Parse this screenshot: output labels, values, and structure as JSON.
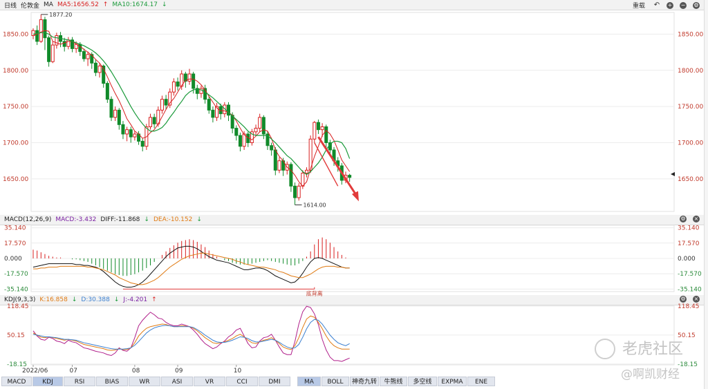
{
  "header": {
    "period": "日线",
    "symbol": "伦敦金",
    "indicator": "MA",
    "ma5": "MA5:1656.52",
    "ma10": "MA10:1674.17",
    "reset": "重载"
  },
  "macd_header": {
    "name": "MACD(12,26,9)",
    "macd": "MACD:-3.432",
    "diff": "DIFF:-11.868",
    "dea": "DEA:-10.152"
  },
  "kdj_header": {
    "name": "KDJ(9,3,3)",
    "k": "K:16.858",
    "d": "D:30.388",
    "j": "J:-4.201"
  },
  "tabs_left": [
    "MACD",
    "KDJ",
    "RSI",
    "BIAS",
    "WR",
    "ASI",
    "VR",
    "CCI",
    "DMI"
  ],
  "tabs_right": [
    "MA",
    "BOLL",
    "神奇九转",
    "牛熊线",
    "多空线",
    "EXPMA",
    "ENE"
  ],
  "watermark": {
    "brand": "老虎社区",
    "author": "@啊凯财经"
  },
  "colors": {
    "up": "#d81e1e",
    "down": "#118a2a",
    "ma_green": "#1a9a3a",
    "orange": "#e07a12",
    "purple": "#b01e8a",
    "blue": "#3a7fd0",
    "black": "#111111"
  },
  "chart_data": [
    {
      "type": "candlestick",
      "title": "伦敦金 日线",
      "yticks": [
        "1850.00",
        "1800.00",
        "1750.00",
        "1700.00",
        "1650.00"
      ],
      "yvalues": [
        1850,
        1800,
        1750,
        1700,
        1650
      ],
      "ylim": [
        1605,
        1880
      ],
      "xticks": [
        "2022/06",
        "07",
        "08",
        "09",
        "10"
      ],
      "annotations": {
        "high": "1877.20",
        "high_value": 1877.2,
        "low": "1614.00",
        "low_value": 1614.0
      },
      "candles": [
        [
          1848,
          1855,
          1843,
          1858
        ],
        [
          1855,
          1840,
          1835,
          1862
        ],
        [
          1840,
          1870,
          1838,
          1877.2
        ],
        [
          1870,
          1845,
          1828,
          1874
        ],
        [
          1845,
          1812,
          1805,
          1848
        ],
        [
          1812,
          1835,
          1810,
          1840
        ],
        [
          1835,
          1848,
          1830,
          1852
        ],
        [
          1848,
          1840,
          1832,
          1853
        ],
        [
          1840,
          1833,
          1826,
          1845
        ],
        [
          1833,
          1842,
          1829,
          1846
        ],
        [
          1842,
          1830,
          1825,
          1846
        ],
        [
          1830,
          1836,
          1824,
          1840
        ],
        [
          1836,
          1826,
          1820,
          1839
        ],
        [
          1826,
          1816,
          1812,
          1830
        ],
        [
          1816,
          1822,
          1806,
          1826
        ],
        [
          1822,
          1810,
          1802,
          1825
        ],
        [
          1810,
          1797,
          1792,
          1815
        ],
        [
          1797,
          1806,
          1790,
          1810
        ],
        [
          1806,
          1782,
          1776,
          1808
        ],
        [
          1782,
          1760,
          1755,
          1785
        ],
        [
          1760,
          1735,
          1730,
          1764
        ],
        [
          1735,
          1745,
          1730,
          1750
        ],
        [
          1745,
          1725,
          1718,
          1748
        ],
        [
          1725,
          1712,
          1705,
          1730
        ],
        [
          1712,
          1718,
          1702,
          1722
        ],
        [
          1718,
          1708,
          1700,
          1722
        ],
        [
          1708,
          1712,
          1703,
          1716
        ],
        [
          1712,
          1702,
          1697,
          1716
        ],
        [
          1702,
          1695,
          1688,
          1706
        ],
        [
          1695,
          1722,
          1690,
          1726
        ],
        [
          1722,
          1735,
          1718,
          1740
        ],
        [
          1735,
          1726,
          1720,
          1740
        ],
        [
          1726,
          1745,
          1722,
          1750
        ],
        [
          1745,
          1760,
          1740,
          1765
        ],
        [
          1760,
          1752,
          1746,
          1766
        ],
        [
          1752,
          1770,
          1748,
          1775
        ],
        [
          1770,
          1784,
          1765,
          1789
        ],
        [
          1784,
          1778,
          1772,
          1790
        ],
        [
          1778,
          1795,
          1773,
          1800
        ],
        [
          1795,
          1785,
          1776,
          1798
        ],
        [
          1785,
          1795,
          1780,
          1802
        ],
        [
          1795,
          1775,
          1768,
          1798
        ],
        [
          1775,
          1768,
          1760,
          1780
        ],
        [
          1768,
          1775,
          1762,
          1779
        ],
        [
          1775,
          1760,
          1754,
          1780
        ],
        [
          1760,
          1745,
          1740,
          1764
        ],
        [
          1745,
          1735,
          1728,
          1750
        ],
        [
          1735,
          1750,
          1730,
          1755
        ],
        [
          1750,
          1740,
          1732,
          1754
        ],
        [
          1740,
          1752,
          1735,
          1756
        ],
        [
          1752,
          1738,
          1730,
          1756
        ],
        [
          1738,
          1720,
          1713,
          1742
        ],
        [
          1720,
          1710,
          1703,
          1724
        ],
        [
          1710,
          1695,
          1688,
          1714
        ],
        [
          1695,
          1712,
          1690,
          1716
        ],
        [
          1712,
          1700,
          1694,
          1715
        ],
        [
          1700,
          1715,
          1696,
          1719
        ],
        [
          1715,
          1720,
          1710,
          1725
        ],
        [
          1720,
          1735,
          1715,
          1740
        ],
        [
          1735,
          1712,
          1705,
          1738
        ],
        [
          1712,
          1696,
          1690,
          1716
        ],
        [
          1696,
          1690,
          1682,
          1700
        ],
        [
          1690,
          1662,
          1655,
          1694
        ],
        [
          1662,
          1675,
          1658,
          1680
        ],
        [
          1675,
          1662,
          1654,
          1679
        ],
        [
          1662,
          1670,
          1656,
          1674
        ],
        [
          1670,
          1640,
          1632,
          1673
        ],
        [
          1640,
          1624,
          1614,
          1645
        ],
        [
          1624,
          1640,
          1620,
          1644
        ],
        [
          1640,
          1658,
          1636,
          1662
        ],
        [
          1658,
          1662,
          1652,
          1666
        ],
        [
          1662,
          1705,
          1658,
          1710
        ],
        [
          1705,
          1728,
          1700,
          1730
        ],
        [
          1728,
          1718,
          1712,
          1732
        ],
        [
          1718,
          1722,
          1708,
          1727
        ],
        [
          1722,
          1700,
          1692,
          1725
        ],
        [
          1700,
          1690,
          1684,
          1704
        ],
        [
          1690,
          1675,
          1668,
          1694
        ],
        [
          1675,
          1668,
          1660,
          1680
        ],
        [
          1668,
          1648,
          1642,
          1672
        ],
        [
          1648,
          1655,
          1644,
          1660
        ],
        [
          1655,
          1652,
          1646,
          1657
        ]
      ],
      "ma5": [
        1848,
        1850,
        1853,
        1855,
        1854,
        1840,
        1838,
        1836,
        1838,
        1840,
        1840,
        1836,
        1833,
        1829,
        1825,
        1821,
        1815,
        1810,
        1802,
        1791,
        1779,
        1768,
        1758,
        1746,
        1733,
        1725,
        1716,
        1712,
        1706,
        1708,
        1714,
        1718,
        1726,
        1736,
        1746,
        1755,
        1761,
        1770,
        1779,
        1786,
        1788,
        1788,
        1785,
        1780,
        1773,
        1764,
        1756,
        1748,
        1744,
        1744,
        1742,
        1738,
        1730,
        1720,
        1711,
        1707,
        1704,
        1709,
        1715,
        1718,
        1716,
        1706,
        1690,
        1681,
        1675,
        1666,
        1662,
        1655,
        1646,
        1640,
        1646,
        1664,
        1681,
        1695,
        1710,
        1717,
        1712,
        1703,
        1690,
        1676,
        1668,
        1660
      ],
      "ma10": [
        1850,
        1851,
        1852,
        1852,
        1850,
        1846,
        1845,
        1844,
        1843,
        1842,
        1840,
        1838,
        1836,
        1834,
        1831,
        1828,
        1824,
        1819,
        1813,
        1806,
        1798,
        1789,
        1780,
        1770,
        1760,
        1750,
        1741,
        1733,
        1726,
        1720,
        1716,
        1716,
        1718,
        1721,
        1727,
        1735,
        1742,
        1750,
        1757,
        1765,
        1770,
        1773,
        1774,
        1773,
        1770,
        1766,
        1762,
        1757,
        1752,
        1747,
        1742,
        1737,
        1732,
        1727,
        1722,
        1716,
        1712,
        1710,
        1710,
        1710,
        1710,
        1705,
        1700,
        1694,
        1688,
        1682,
        1678,
        1672,
        1666,
        1660,
        1656,
        1660,
        1666,
        1672,
        1680,
        1690,
        1698,
        1702,
        1702,
        1700,
        1692,
        1678
      ]
    },
    {
      "type": "bar+line",
      "title": "MACD(12,26,9)",
      "yticks": [
        "35.140",
        "17.570",
        "0.000",
        "-17.570",
        "-35.140"
      ],
      "yvalues": [
        35.14,
        17.57,
        0,
        -17.57,
        -35.14
      ],
      "ylim": [
        -38,
        38
      ],
      "annotation": "底背离",
      "macd_hist": [
        10,
        9,
        7,
        5,
        3,
        2,
        1,
        1,
        0,
        0,
        -1,
        -1,
        -2,
        -3,
        -4,
        -6,
        -8,
        -10,
        -12,
        -14,
        -16,
        -18,
        -19,
        -20,
        -20,
        -19,
        -18,
        -16,
        -14,
        -11,
        -8,
        -4,
        0,
        4,
        8,
        12,
        15,
        18,
        20,
        21,
        22,
        21,
        19,
        16,
        13,
        9,
        5,
        2,
        0,
        -2,
        -3,
        -5,
        -6,
        -7,
        -7,
        -7,
        -6,
        -5,
        -4,
        -3,
        -2,
        -3,
        -4,
        -5,
        -6,
        -7,
        -8,
        -8,
        -6,
        -3,
        2,
        8,
        16,
        22,
        24,
        22,
        18,
        13,
        8,
        4,
        1,
        0
      ],
      "diff": [
        -10,
        -9,
        -8,
        -7,
        -6,
        -6,
        -6,
        -6,
        -6,
        -6,
        -6,
        -7,
        -7,
        -8,
        -8,
        -9,
        -10,
        -12,
        -15,
        -19,
        -23,
        -27,
        -30,
        -32,
        -33,
        -33,
        -32,
        -30,
        -27,
        -23,
        -18,
        -13,
        -8,
        -3,
        2,
        6,
        9,
        12,
        13,
        14,
        14,
        13,
        11,
        8,
        5,
        2,
        0,
        -2,
        -3,
        -4,
        -5,
        -7,
        -9,
        -11,
        -13,
        -13,
        -12,
        -11,
        -11,
        -12,
        -14,
        -17,
        -20,
        -22,
        -24,
        -26,
        -28,
        -27,
        -23,
        -17,
        -10,
        -4,
        0,
        1,
        0,
        -2,
        -4,
        -6,
        -8,
        -10,
        -11,
        -11
      ],
      "dea": [
        -12,
        -12,
        -11,
        -11,
        -10,
        -10,
        -10,
        -9,
        -9,
        -9,
        -9,
        -9,
        -9,
        -9,
        -10,
        -10,
        -11,
        -12,
        -13,
        -15,
        -17,
        -19,
        -22,
        -24,
        -26,
        -28,
        -29,
        -30,
        -30,
        -29,
        -27,
        -25,
        -22,
        -18,
        -14,
        -10,
        -7,
        -4,
        -1,
        1,
        3,
        4,
        5,
        6,
        6,
        5,
        4,
        3,
        2,
        1,
        0,
        -1,
        -3,
        -4,
        -6,
        -7,
        -8,
        -9,
        -10,
        -10,
        -11,
        -12,
        -13,
        -15,
        -16,
        -18,
        -20,
        -21,
        -22,
        -22,
        -20,
        -18,
        -15,
        -12,
        -10,
        -9,
        -9,
        -9,
        -10,
        -10,
        -11,
        -11
      ]
    },
    {
      "type": "line",
      "title": "KDJ(9,3,3)",
      "yticks": [
        "118.45",
        "50.15",
        "-18.15"
      ],
      "yvalues": [
        118.45,
        50.15,
        -18.15
      ],
      "ylim": [
        -20,
        120
      ],
      "k": [
        55,
        50,
        45,
        44,
        46,
        44,
        42,
        40,
        38,
        40,
        38,
        36,
        32,
        28,
        26,
        24,
        22,
        20,
        18,
        15,
        14,
        15,
        18,
        16,
        16,
        20,
        32,
        48,
        58,
        66,
        70,
        72,
        74,
        76,
        75,
        72,
        70,
        70,
        72,
        71,
        70,
        66,
        60,
        52,
        44,
        38,
        32,
        30,
        32,
        34,
        38,
        42,
        48,
        52,
        46,
        38,
        32,
        30,
        34,
        38,
        40,
        44,
        38,
        30,
        22,
        18,
        16,
        25,
        44,
        68,
        88,
        95,
        92,
        80,
        65,
        48,
        34,
        25,
        20,
        17,
        17,
        17
      ],
      "d": [
        52,
        50,
        48,
        46,
        46,
        45,
        44,
        42,
        40,
        40,
        39,
        38,
        35,
        32,
        30,
        28,
        26,
        24,
        22,
        20,
        18,
        17,
        17,
        17,
        18,
        20,
        26,
        35,
        45,
        55,
        62,
        67,
        70,
        72,
        73,
        72,
        70,
        70,
        70,
        70,
        70,
        68,
        63,
        57,
        50,
        44,
        38,
        34,
        33,
        33,
        35,
        38,
        42,
        46,
        45,
        42,
        37,
        34,
        34,
        36,
        38,
        40,
        38,
        33,
        27,
        22,
        19,
        20,
        28,
        45,
        65,
        80,
        87,
        85,
        76,
        63,
        50,
        40,
        32,
        28,
        25,
        30
      ],
      "j": [
        60,
        48,
        40,
        38,
        45,
        42,
        36,
        34,
        30,
        38,
        34,
        32,
        26,
        20,
        18,
        15,
        12,
        10,
        8,
        4,
        2,
        8,
        20,
        14,
        12,
        20,
        44,
        72,
        85,
        95,
        104,
        98,
        90,
        88,
        80,
        75,
        72,
        72,
        76,
        73,
        70,
        62,
        52,
        40,
        30,
        24,
        18,
        22,
        30,
        36,
        46,
        52,
        62,
        66,
        48,
        30,
        20,
        22,
        36,
        44,
        46,
        52,
        38,
        22,
        8,
        4,
        4,
        35,
        76,
        105,
        118,
        115,
        100,
        75,
        40,
        15,
        -2,
        -10,
        -10,
        -12,
        -8,
        -4
      ]
    }
  ]
}
